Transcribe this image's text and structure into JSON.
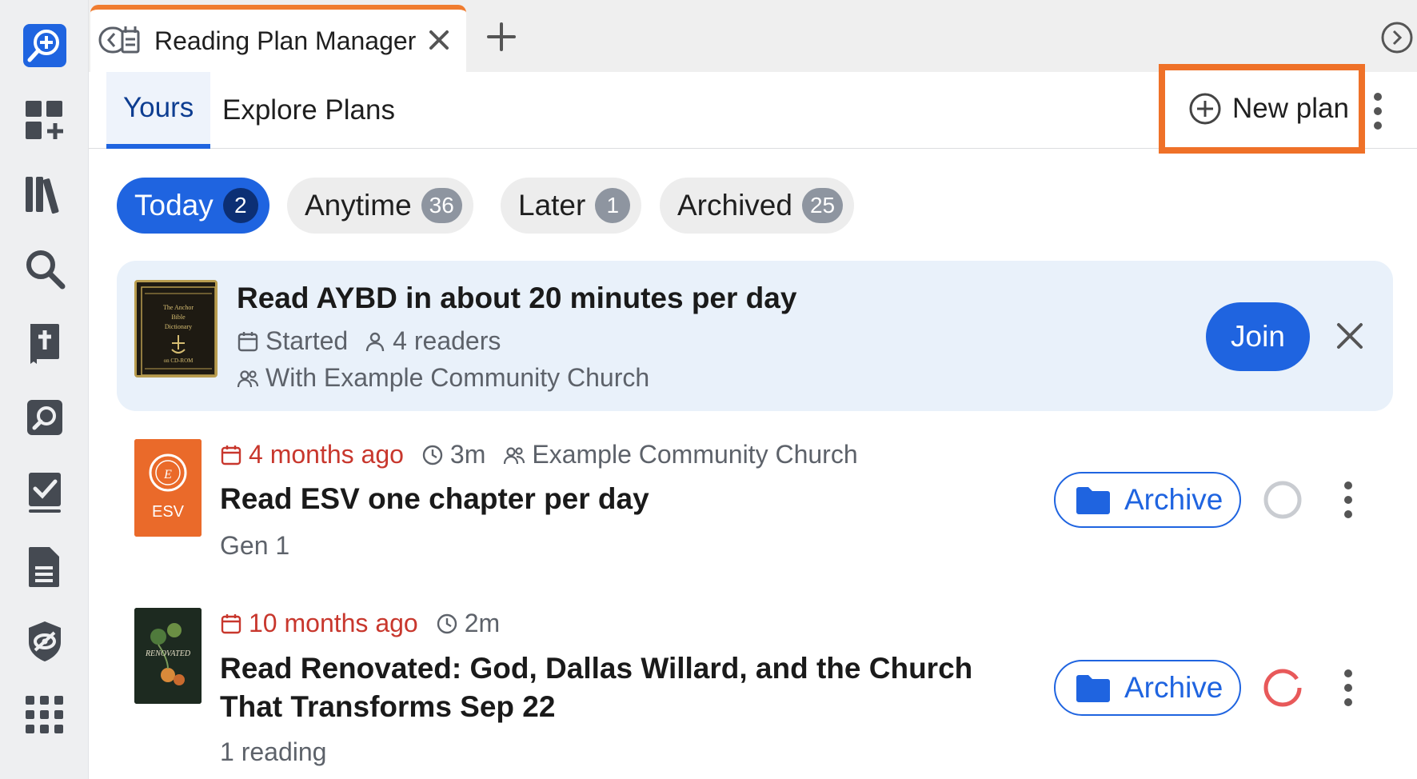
{
  "colors": {
    "accent": "#1f64e0",
    "highlight_frame": "#ef7128",
    "overdue": "#c8372d",
    "muted_text": "#5d626a",
    "promo_bg": "#e9f1fa"
  },
  "rail": {
    "items": [
      {
        "icon": "reading-plan-add-icon"
      },
      {
        "icon": "dashboard-add-icon"
      },
      {
        "icon": "library-icon"
      },
      {
        "icon": "search-icon"
      },
      {
        "icon": "bible-icon"
      },
      {
        "icon": "bible-search-icon"
      },
      {
        "icon": "checklist-icon"
      },
      {
        "icon": "document-icon"
      },
      {
        "icon": "shield-eye-icon"
      },
      {
        "icon": "apps-grid-icon"
      }
    ]
  },
  "tab": {
    "title": "Reading Plan Manager",
    "icon": "reading-plan-tab-icon"
  },
  "subnav": {
    "tabs": [
      {
        "label": "Yours",
        "active": true
      },
      {
        "label": "Explore Plans",
        "active": false
      }
    ],
    "new_plan_label": "New plan"
  },
  "filters": [
    {
      "label": "Today",
      "count": "2",
      "active": true
    },
    {
      "label": "Anytime",
      "count": "36",
      "active": false
    },
    {
      "label": "Later",
      "count": "1",
      "active": false
    },
    {
      "label": "Archived",
      "count": "25",
      "active": false
    }
  ],
  "promo": {
    "title": "Read AYBD in about 20 minutes per day",
    "status": "Started",
    "readers": "4 readers",
    "group": "With Example Community Church",
    "join_label": "Join",
    "cover_text": [
      "The Anchor",
      "Bible",
      "Dictionary",
      "on CD-ROM"
    ]
  },
  "plans": [
    {
      "due": "4 months ago",
      "duration": "3m",
      "group": "Example Community Church",
      "title": "Read ESV one chapter per day",
      "subtitle": "Gen 1",
      "archive_label": "Archive",
      "cover_label": "ESV",
      "progress": 0
    },
    {
      "due": "10 months ago",
      "duration": "2m",
      "title": "Read Renovated: God, Dallas Willard, and the Church That Transforms Sep 22",
      "subtitle": "1 reading",
      "archive_label": "Archive",
      "cover_label": "RENOVATED",
      "progress": 0
    }
  ]
}
